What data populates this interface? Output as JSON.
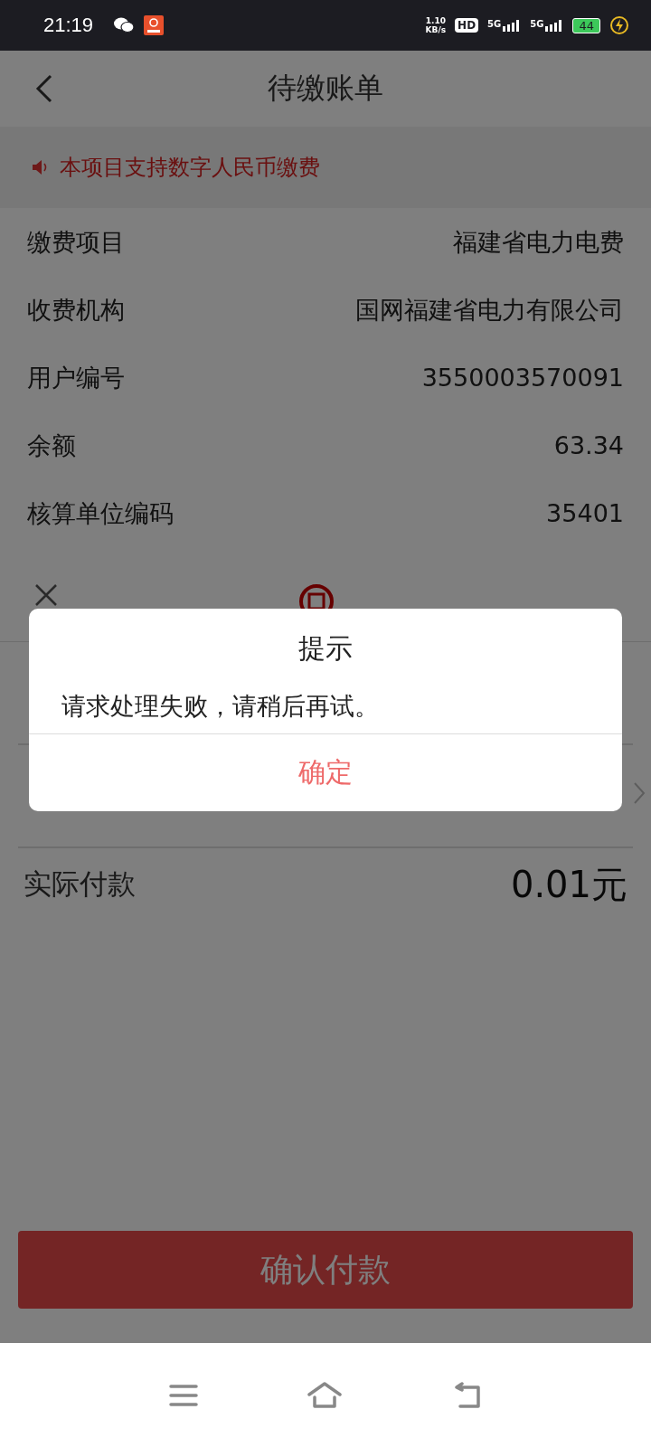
{
  "status_bar": {
    "time": "21:19",
    "speed_value": "1.10",
    "speed_unit": "KB/s",
    "hd": "HD",
    "networks": [
      "5G",
      "5G"
    ],
    "battery": "44"
  },
  "header": {
    "title": "待缴账单"
  },
  "notice": {
    "text": "本项目支持数字人民币缴费"
  },
  "details": [
    {
      "label": "缴费项目",
      "value": "福建省电力电费"
    },
    {
      "label": "收费机构",
      "value": "国网福建省电力有限公司"
    },
    {
      "label": "用户编号",
      "value": "3550003570091"
    },
    {
      "label": "余额",
      "value": "63.34"
    },
    {
      "label": "核算单位编码",
      "value": "35401"
    }
  ],
  "payment_sheet": {
    "actual_label": "实际付款",
    "actual_value": "0.01元",
    "confirm_button": "确认付款"
  },
  "dialog": {
    "title": "提示",
    "message": "请求处理失败，请稍后再试。",
    "button": "确定"
  }
}
